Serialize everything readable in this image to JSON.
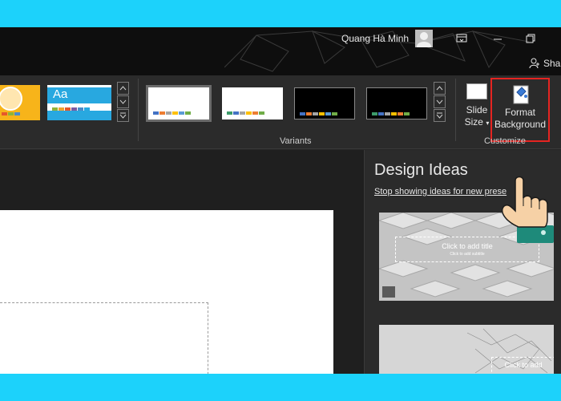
{
  "titlebar": {
    "user_name": "Quang Hà Minh",
    "share_label": "Shar",
    "icons": [
      "ribbon-display-icon",
      "minimize-icon",
      "restore-icon",
      "share-person-icon"
    ]
  },
  "ribbon": {
    "variants_label": "Variants",
    "customize_label": "Customize",
    "slide_size": {
      "line1": "Slide",
      "line2": "Size"
    },
    "format_background": {
      "line1": "Format",
      "line2": "Background"
    },
    "theme_text": "Aa"
  },
  "design_ideas": {
    "title": "Design Ideas",
    "link": "Stop showing ideas for new prese",
    "idea1_placeholder": "Click to add title",
    "idea1_subtitle": "Click to add subtitle",
    "idea2_placeholder": "Click to add"
  },
  "colors": {
    "border_highlight": "#e52421",
    "theme_yellow": "#f7b41a",
    "theme_blue": "#28a8e0",
    "frame": "#1cd2fb"
  }
}
